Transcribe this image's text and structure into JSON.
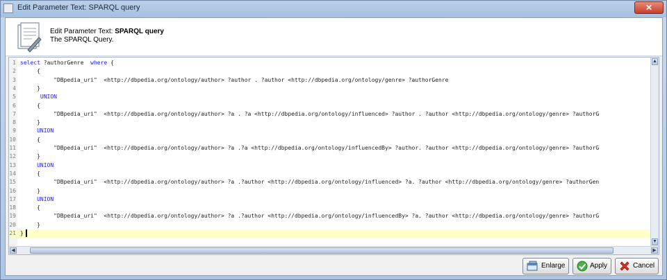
{
  "window": {
    "title": "Edit Parameter Text: SPARQL query",
    "close_label": "✕"
  },
  "header": {
    "prefix": "Edit Parameter Text: ",
    "name": "SPARQL query",
    "description": "The SPARQL Query."
  },
  "editor": {
    "lines": [
      {
        "num": "1",
        "text": "select ?authorGenre  where {"
      },
      {
        "num": "2",
        "text": "     {"
      },
      {
        "num": "3",
        "text": "          \"DBpedia_uri\"  <http://dbpedia.org/ontology/author> ?author . ?author <http://dbpedia.org/ontology/genre> ?authorGenre"
      },
      {
        "num": "4",
        "text": "     }"
      },
      {
        "num": "5",
        "text": "      UNION"
      },
      {
        "num": "6",
        "text": "     {"
      },
      {
        "num": "7",
        "text": "          \"DBpedia_uri\"  <http://dbpedia.org/ontology/author> ?a . ?a <http://dbpedia.org/ontology/influenced> ?author . ?author <http://dbpedia.org/ontology/genre> ?authorG"
      },
      {
        "num": "8",
        "text": "     }"
      },
      {
        "num": "9",
        "text": "     UNION"
      },
      {
        "num": "10",
        "text": "     {"
      },
      {
        "num": "11",
        "text": "          \"DBpedia_uri\"  <http://dbpedia.org/ontology/author> ?a .?a <http://dbpedia.org/ontology/influencedBy> ?author. ?author <http://dbpedia.org/ontology/genre> ?authorG"
      },
      {
        "num": "12",
        "text": "     }"
      },
      {
        "num": "13",
        "text": "     UNION"
      },
      {
        "num": "14",
        "text": "     {"
      },
      {
        "num": "15",
        "text": "          \"DBpedia_uri\"  <http://dbpedia.org/ontology/author> ?a .?author <http://dbpedia.org/ontology/influenced> ?a. ?author <http://dbpedia.org/ontology/genre> ?authorGen"
      },
      {
        "num": "16",
        "text": "     }"
      },
      {
        "num": "17",
        "text": "     UNION"
      },
      {
        "num": "18",
        "text": "     {"
      },
      {
        "num": "19",
        "text": "          \"DBpedia_uri\"  <http://dbpedia.org/ontology/author> ?a .?author <http://dbpedia.org/ontology/influencedBy> ?a. ?author <http://dbpedia.org/ontology/genre> ?authorG"
      },
      {
        "num": "20",
        "text": "     }"
      },
      {
        "num": "21",
        "text": "}"
      }
    ],
    "current_line": 21,
    "keywords": [
      "select",
      "where",
      "UNION"
    ],
    "keyword_color": "#1a1aff"
  },
  "buttons": {
    "enlarge_label": "Enlarge",
    "apply_label": "Apply",
    "cancel_label": "Cancel"
  }
}
